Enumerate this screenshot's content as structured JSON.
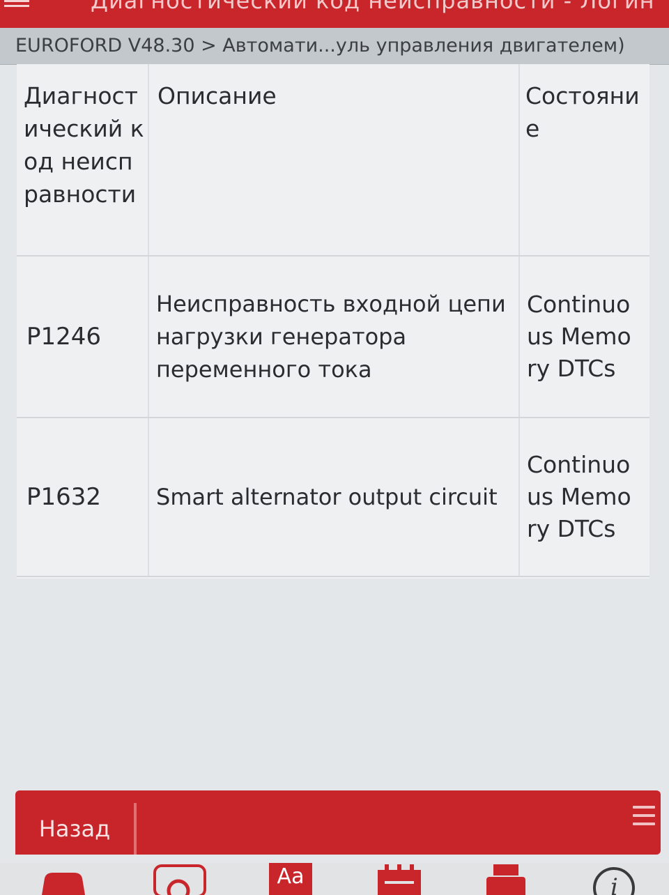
{
  "app": {
    "title": "Диагностический код неисправности - Логин"
  },
  "breadcrumb": "EUROFORD V48.30 > Автомати...уль управления двигателем)",
  "table": {
    "headers": {
      "code": "Диагностический код неисправности",
      "description": "Описание",
      "state": "Состояние"
    },
    "rows": [
      {
        "code": "P1246",
        "description": "Неисправность входной цепи нагрузки генератора переменного тока",
        "state": "Continuous Memory DTCs"
      },
      {
        "code": "P1632",
        "description": "Smart alternator output circuit",
        "state": "Continuous Memory DTCs"
      }
    ]
  },
  "bottom_bar": {
    "back_label": "Назад",
    "menu_icon": "hamburger-icon"
  },
  "toolbar": {
    "items": [
      {
        "icon": "car-icon"
      },
      {
        "icon": "search-icon"
      },
      {
        "icon": "font-size-icon",
        "label": "Aa"
      },
      {
        "icon": "calendar-icon"
      },
      {
        "icon": "printer-icon"
      },
      {
        "icon": "info-icon"
      }
    ]
  },
  "colors": {
    "accent": "#c9262b",
    "breadcrumb_bg": "#c3c8cc",
    "table_bg": "#eef0f1"
  }
}
